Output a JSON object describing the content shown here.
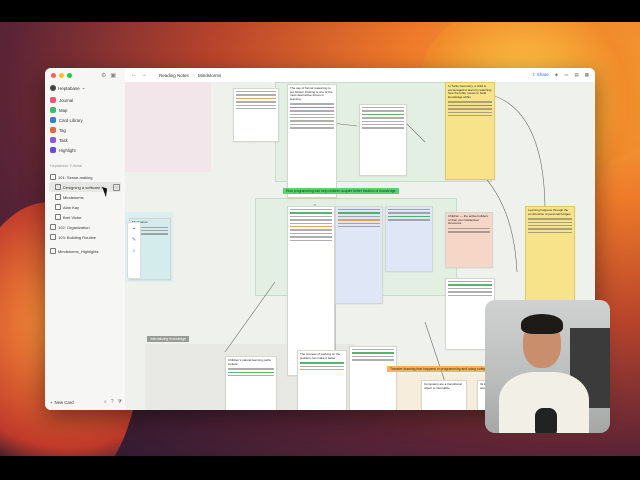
{
  "workspace": {
    "name": "Heptabase"
  },
  "nav": [
    {
      "label": "Journal",
      "color": "#e05a7a"
    },
    {
      "label": "Map",
      "color": "#3fb96a"
    },
    {
      "label": "Card Library",
      "color": "#3b7bd8"
    },
    {
      "label": "Tag",
      "color": "#e06a3a"
    },
    {
      "label": "Task",
      "color": "#8a5ad6"
    },
    {
      "label": "Highlight",
      "color": "#6a4ad6"
    }
  ],
  "sidebar": {
    "section_label": "Heptabase Tutorial",
    "tree": [
      {
        "label": "101: Sense-making",
        "indent": false,
        "active": false
      },
      {
        "label": "Designing a software f...",
        "indent": true,
        "active": true
      },
      {
        "label": "Mindstorms",
        "indent": true,
        "active": false
      },
      {
        "label": "Alan Kay",
        "indent": true,
        "active": false
      },
      {
        "label": "Bret Victor",
        "indent": true,
        "active": false
      },
      {
        "label": "102: Organization",
        "indent": false,
        "active": false
      },
      {
        "label": "103: Building Routine",
        "indent": false,
        "active": false
      },
      {
        "label": "Mindstorms_Highlights",
        "indent": false,
        "active": false
      }
    ],
    "new_card": "New Card"
  },
  "topbar": {
    "crumb1": "Reading Notes",
    "crumb2": "Mindstorms",
    "share": "Share"
  },
  "canvas": {
    "banner_green": "How programming can help children acquire better intuition of knowledge",
    "banner_grey": "Internalizing Knowledge",
    "banner_orange": "Transfer learning that happens in programming and using software",
    "card_heads": {
      "top_left": "The use of formal reasoning to put bluster thinking is one of the most destructive forces in learning.",
      "top_yellow": "In Turtle Geometry, a child is encouraged to learn by watching how the turtle moves to build knowledge within",
      "mid_left": "Children — the active builders of their own intellectual structures.",
      "mid_right": "Learning happens through the construction of personal bridges",
      "left_card": "Mindstorms",
      "bottom_left": "Children's natural learning paths include",
      "bottom_mid": "The process of working on the problem can make it better",
      "bottom_right": "Computers are a transitional object to internalize",
      "bottom_far": "Its knowledge is initially accessible"
    }
  },
  "colors": {
    "accent": "#2f6fd6",
    "green_banner": "#58d26a",
    "orange_banner": "#f2b65a",
    "yellow_card": "#f7e38a"
  }
}
